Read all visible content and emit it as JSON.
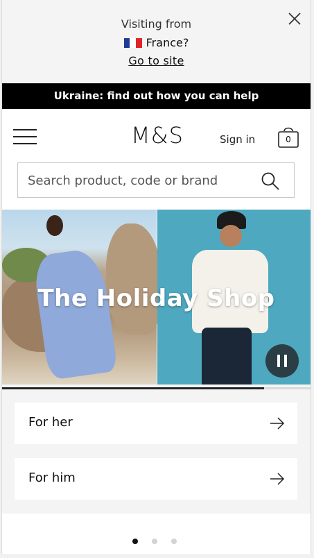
{
  "visit": {
    "line1": "Visiting from",
    "country": "France?",
    "link": "Go to site",
    "flag_colors": [
      "#1f3b94",
      "#ffffff",
      "#e0242a"
    ]
  },
  "ukraine_banner": "Ukraine: find out how you can help",
  "header": {
    "logo": "M&S",
    "sign_in": "Sign in",
    "bag_count": "0"
  },
  "search": {
    "placeholder": "Search product, code or brand"
  },
  "hero": {
    "title": "The Holiday Shop",
    "progress": 0.85
  },
  "categories": [
    {
      "label": "For her"
    },
    {
      "label": "For him"
    }
  ],
  "carousel": {
    "dots": 3,
    "active": 0
  },
  "colors": {
    "banner_bg": "#000000",
    "hero_right_bg": "#4ea8c0",
    "pause_bg": "#2b3e45"
  }
}
